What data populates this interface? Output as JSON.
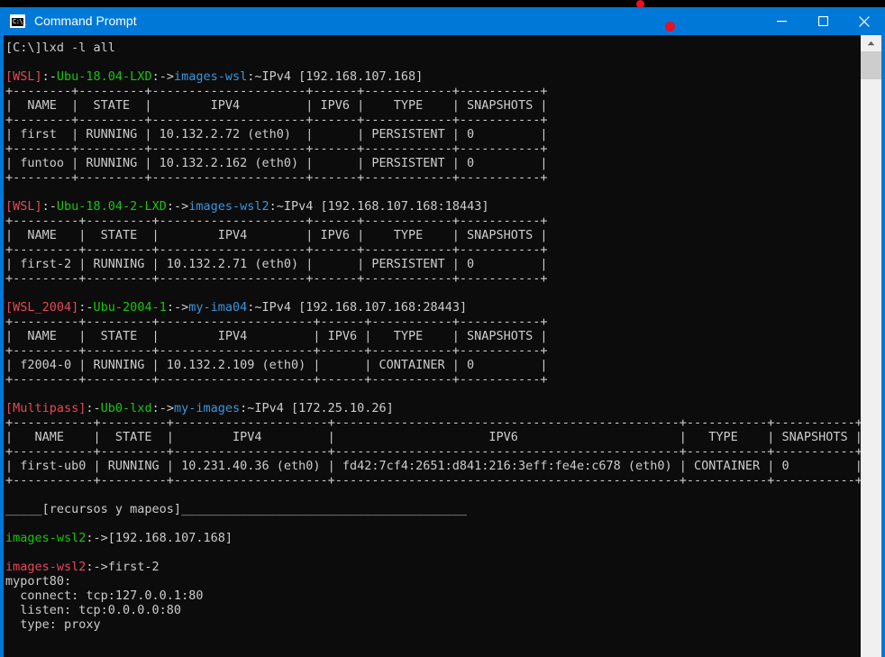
{
  "window": {
    "title": "Command Prompt",
    "icon": "cmd-icon",
    "icon_glyph": "C:\\_",
    "minimize_label": "Minimize",
    "maximize_label": "Maximize",
    "close_label": "Close",
    "titlebar_color": "#0078d7",
    "background_color": "#0c0c0c",
    "accent_marker_color": "#e81123"
  },
  "scrollbar": {
    "up_arrow": "scroll-up-arrow",
    "thumb_position_percent": 3
  },
  "terminal": {
    "colors": {
      "default": "#cccccc",
      "red": "#e74856",
      "green": "#16c60c",
      "cyan": "#3a96dd"
    },
    "command_line": "[C:\\]lxd -l all",
    "sections": [
      {
        "prompt": {
          "tag": "[WSL]",
          "sep1": ":-",
          "host": "Ubu-18.04-LXD",
          "sep2": ":->",
          "remote": "images-wsl",
          "tail": ":~IPv4 [192.168.107.168]"
        },
        "table": {
          "headers": [
            "NAME",
            "STATE",
            "IPV4",
            "IPV6",
            "TYPE",
            "SNAPSHOTS"
          ],
          "rows": [
            [
              "first",
              "RUNNING",
              "10.132.2.72 (eth0)",
              "",
              "PERSISTENT",
              "0"
            ],
            [
              "funtoo",
              "RUNNING",
              "10.132.2.162 (eth0)",
              "",
              "PERSISTENT",
              "0"
            ]
          ]
        }
      },
      {
        "prompt": {
          "tag": "[WSL]",
          "sep1": ":-",
          "host": "Ubu-18.04-2-LXD",
          "sep2": ":->",
          "remote": "images-wsl2",
          "tail": ":~IPv4 [192.168.107.168:18443]"
        },
        "table": {
          "headers": [
            "NAME",
            "STATE",
            "IPV4",
            "IPV6",
            "TYPE",
            "SNAPSHOTS"
          ],
          "rows": [
            [
              "first-2",
              "RUNNING",
              "10.132.2.71 (eth0)",
              "",
              "PERSISTENT",
              "0"
            ]
          ]
        }
      },
      {
        "prompt": {
          "tag": "[WSL_2004]",
          "sep1": ":-",
          "host": "Ubu-2004-1",
          "sep2": ":->",
          "remote": "my-ima04",
          "tail": ":~IPv4 [192.168.107.168:28443]"
        },
        "table": {
          "headers": [
            "NAME",
            "STATE",
            "IPV4",
            "IPV6",
            "TYPE",
            "SNAPSHOTS"
          ],
          "rows": [
            [
              "f2004-0",
              "RUNNING",
              "10.132.2.109 (eth0)",
              "",
              "CONTAINER",
              "0"
            ]
          ]
        }
      },
      {
        "prompt": {
          "tag": "[Multipass]",
          "sep1": ":-",
          "host": "Ub0-lxd",
          "sep2": ":->",
          "remote": "my-images",
          "tail": ":~IPv4 [172.25.10.26]"
        },
        "table": {
          "headers": [
            "NAME",
            "STATE",
            "IPV4",
            "IPV6",
            "TYPE",
            "SNAPSHOTS"
          ],
          "rows": [
            [
              "first-ub0",
              "RUNNING",
              "10.231.40.36 (eth0)",
              "fd42:7cf4:2651:d841:216:3eff:fe4e:c678 (eth0)",
              "CONTAINER",
              "0"
            ]
          ]
        }
      }
    ],
    "resources_banner": "_____[recursos y mapeos]_______________________________________",
    "resource_blocks": [
      {
        "name": "images-wsl2",
        "name_color": "green",
        "sep": ":->",
        "value": "[192.168.107.168]",
        "details": []
      },
      {
        "name": "images-wsl2",
        "name_color": "red",
        "sep": ":->",
        "value": "first-2",
        "details": [
          "myport80:",
          "  connect: tcp:127.0.0.1:80",
          "  listen: tcp:0.0.0.0:80",
          "  type: proxy"
        ]
      }
    ],
    "footer_rule": "______________________________________________________________"
  }
}
